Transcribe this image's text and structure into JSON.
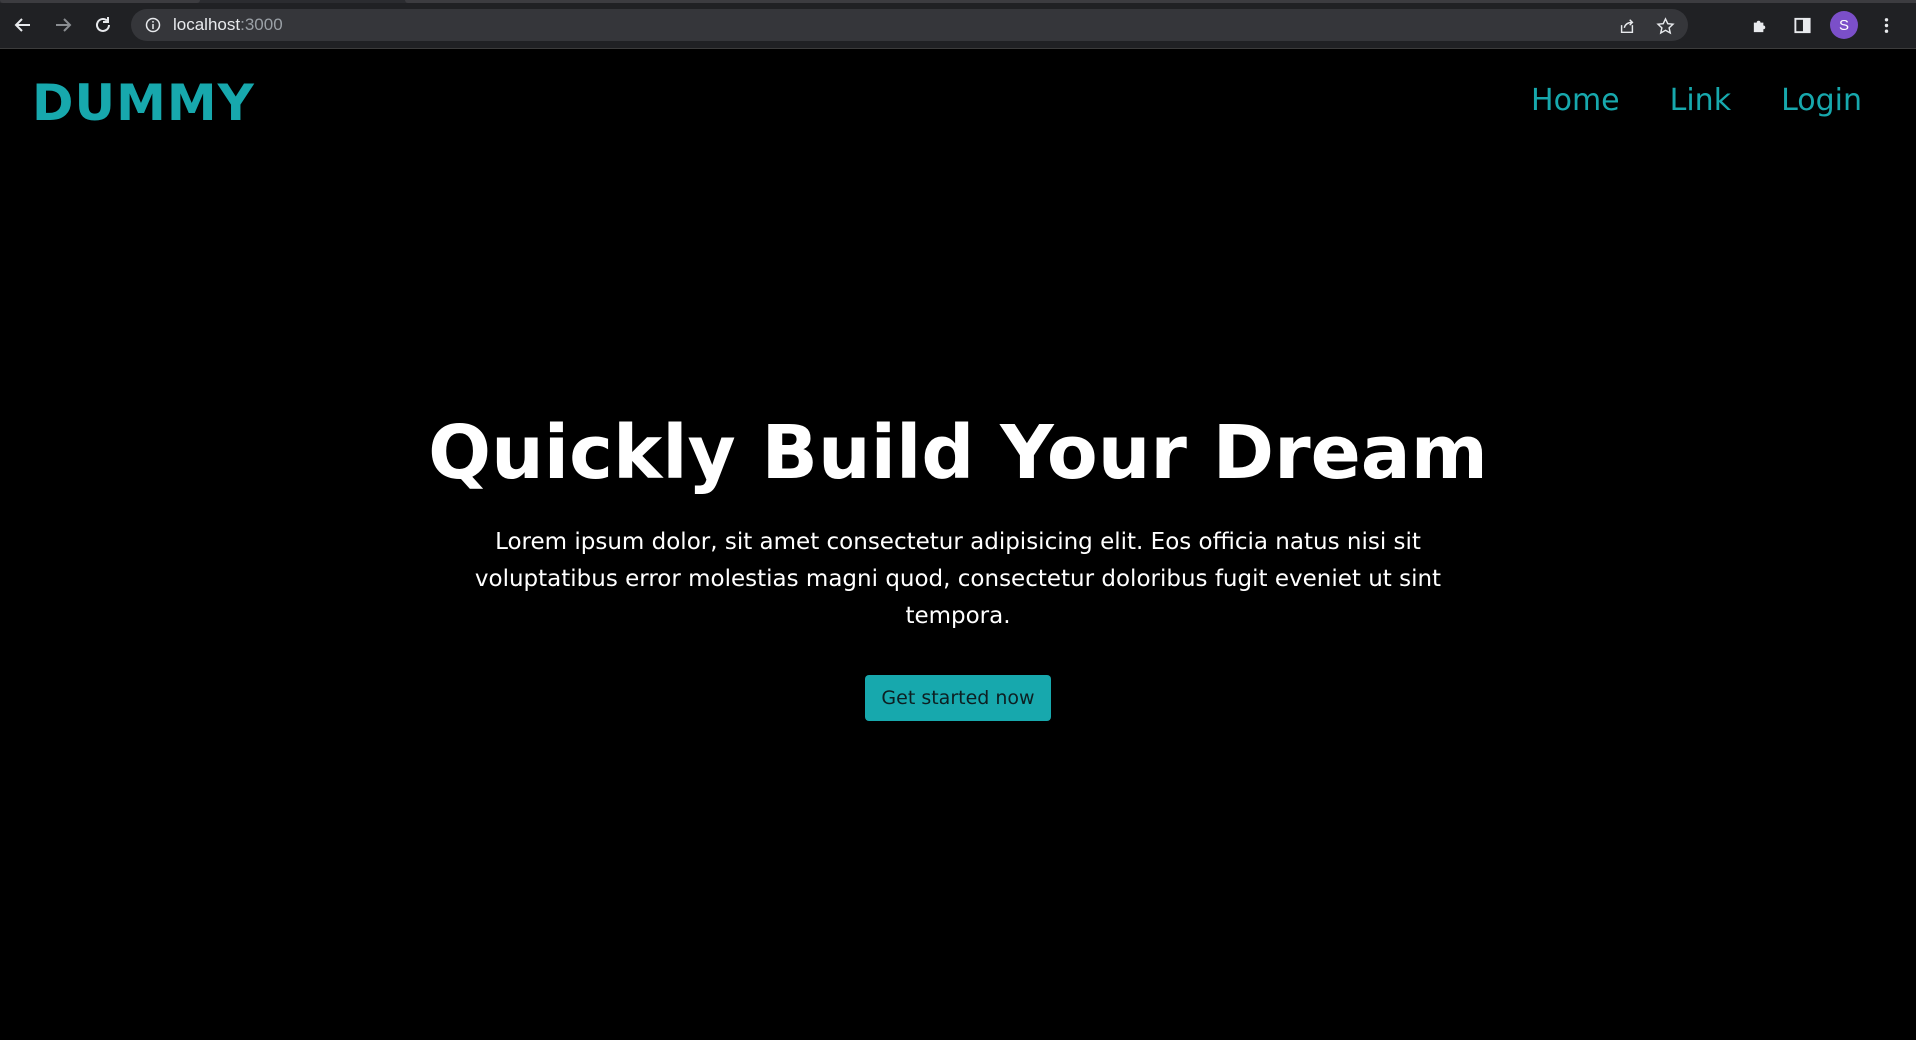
{
  "browser": {
    "url_host": "localhost",
    "url_port": ":3000",
    "profile_initial": "S",
    "icons": {
      "back": "arrow-left-icon",
      "forward": "arrow-right-icon",
      "reload": "reload-icon",
      "info": "info-icon",
      "share": "share-icon",
      "bookmark": "star-icon",
      "extensions": "puzzle-icon",
      "side_panel": "side-panel-icon",
      "menu": "kebab-menu-icon"
    }
  },
  "site": {
    "brand": "DUMMY",
    "nav": [
      {
        "label": "Home"
      },
      {
        "label": "Link"
      },
      {
        "label": "Login"
      }
    ]
  },
  "hero": {
    "title": "Quickly Build Your Dream",
    "description": "Lorem ipsum dolor, sit amet consectetur adipisicing elit. Eos officia natus nisi sit voluptatibus error molestias magni quod, consectetur doloribus fugit eveniet ut sint tempora.",
    "cta_label": "Get started now"
  },
  "colors": {
    "accent": "#17a8ad",
    "background": "#000000",
    "text": "#ffffff"
  }
}
